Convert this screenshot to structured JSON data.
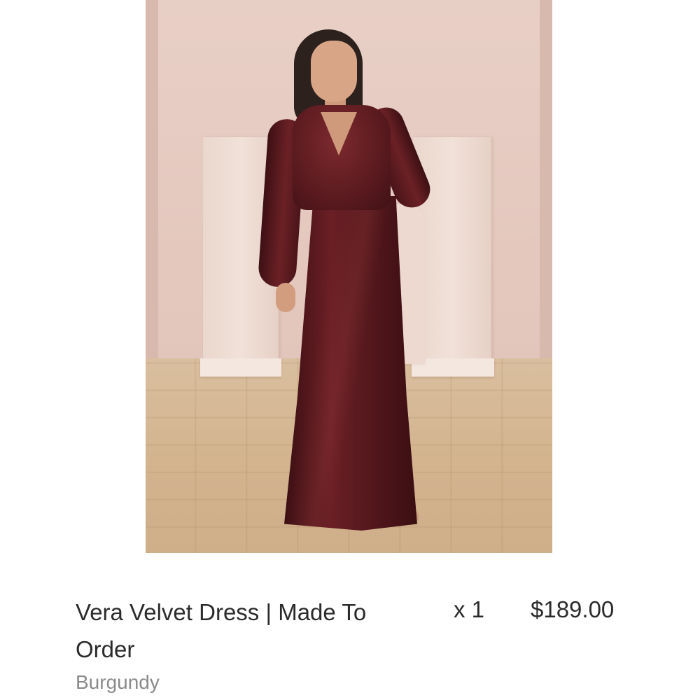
{
  "cart_item": {
    "image_alt": "Vera Velvet Dress in Burgundy",
    "title": "Vera Velvet Dress | Made To Order",
    "variant": "Burgundy",
    "quantity": "x 1",
    "price": "$189.00"
  }
}
